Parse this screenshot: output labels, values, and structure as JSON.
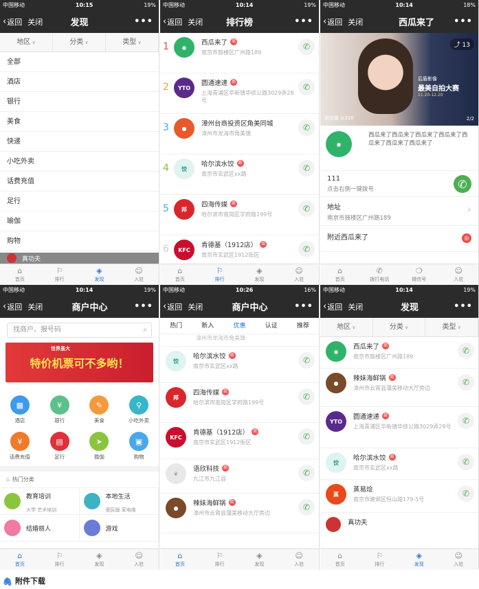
{
  "status": {
    "carrier": "中国移动",
    "s1time": "10:15",
    "s1bat": "19%",
    "s2time": "10:14",
    "s2bat": "19%",
    "s3time": "10:14",
    "s3bat": "18%",
    "s4time": "10:14",
    "s4bat": "19%",
    "s5time": "10:26",
    "s5bat": "16%",
    "s6time": "10:14",
    "s6bat": "19%"
  },
  "nav": {
    "back": "返回",
    "close": "关闭",
    "more": "•••",
    "t1": "发现",
    "t2": "排行榜",
    "t3": "西瓜来了",
    "t4": "商户中心",
    "t5": "商户中心",
    "t6": "发现"
  },
  "filter": {
    "area": "地区",
    "cls": "分类",
    "type": "类型"
  },
  "cats": [
    "全部",
    "酒店",
    "银行",
    "美食",
    "快递",
    "小吃外卖",
    "话费充值",
    "足行",
    "瑜伽",
    "购物"
  ],
  "p1peek": "真功夫",
  "tabs": {
    "home": "首页",
    "rank": "排行",
    "discover": "发现",
    "join": "入驻"
  },
  "rank": [
    {
      "n": "1",
      "name": "西瓜来了",
      "addr": "南京市鼓楼区广州路189"
    },
    {
      "n": "2",
      "name": "圆通速递",
      "addr": "上海青浦区华新镇华徐公路3029弄28号"
    },
    {
      "n": "3",
      "name": "漳州台商投资区角美同城",
      "addr": "漳州市龙海市角美镇"
    },
    {
      "n": "4",
      "name": "哈尔滨水饺",
      "addr": "南京市玄武区xx路"
    },
    {
      "n": "5",
      "name": "四海传媒",
      "addr": "哈尔滨市南岗区学府路199号"
    },
    {
      "n": "6",
      "name": "肯德基（1912店）",
      "addr": "南京市玄武区1912街区"
    }
  ],
  "shop": {
    "share": "13",
    "views": "浏览量 ◎310",
    "page": "2/2",
    "promoTag": "后盾影像",
    "promoTitle": "最美自拍大赛",
    "promoDate": "11.20-12.20",
    "desc": "西瓜来了西瓜来了西瓜来了西瓜来了西瓜来了西瓜来了西瓜来了",
    "phone": "111",
    "phoneHint": "点击右侧一键拨号",
    "addrLabel": "地址",
    "addr": "南京市鼓楼区广州路189",
    "near": "附近西瓜来了",
    "tabPhone": "拨打电话",
    "tabWechat": "微信号",
    "tabJoin": "入驻"
  },
  "center": {
    "search": "找商户、报号码",
    "banner": "特价机票可不多哟！",
    "bannerTop": "世界虽大",
    "grid": [
      "酒店",
      "银行",
      "美食",
      "小吃外卖",
      "话费充值",
      "足行",
      "瑜伽",
      "购物"
    ],
    "hot": "热门分类",
    "hot1": "教育培训",
    "hot1s": "大学  艺术培训",
    "hot2": "本地生活",
    "hot2s": "便民服  家电维",
    "hot3": "结婚丽人",
    "hot4": "游戏"
  },
  "tabs5": [
    "热门",
    "新入",
    "优惠",
    "认证",
    "推荐"
  ],
  "list5": [
    {
      "name": "哈尔滨水饺",
      "addr": "南京市玄武区xx路"
    },
    {
      "name": "四海传媒",
      "addr": "哈尔滨市南岗区学府路199号"
    },
    {
      "name": "肯德基（1912店）",
      "addr": "南京市玄武区1912街区"
    },
    {
      "name": "语欣科技",
      "addr": "九江市九江县"
    },
    {
      "name": "辣妹海鲜锅",
      "addr": "漳州市云霄县蒲美移动大厅旁边"
    }
  ],
  "list5top": "漳州市龙海市角美镇",
  "list6": [
    {
      "name": "西瓜来了",
      "addr": "南京市鼓楼区广州路189"
    },
    {
      "name": "辣妹海鲜锅",
      "addr": "漳州市云霄县蒲美移动大厅旁边"
    },
    {
      "name": "圆通速递",
      "addr": "上海青浦区华新镇华徐公路3029弄28号"
    },
    {
      "name": "哈尔滨水饺",
      "addr": "南京市玄武区xx路"
    },
    {
      "name": "蒸易烩",
      "addr": "南京市建邺区恒山路179-5号"
    },
    {
      "name": "真功夫",
      "addr": ""
    }
  ],
  "footer": "附件下载"
}
